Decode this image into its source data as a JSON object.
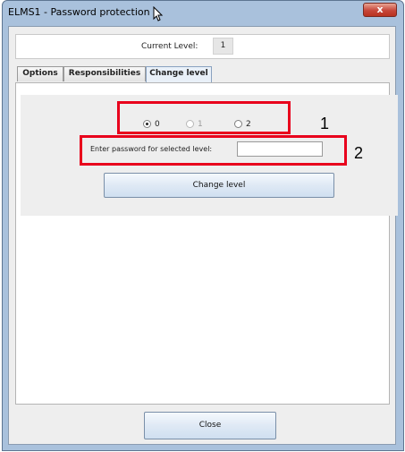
{
  "window": {
    "title": "ELMS1 - Password protection",
    "close_glyph": "x"
  },
  "level_panel": {
    "label": "Current Level:",
    "value": "1"
  },
  "tabs": [
    {
      "label": "Options",
      "active": false
    },
    {
      "label": "Responsibilities",
      "active": false
    },
    {
      "label": "Change level",
      "active": true
    }
  ],
  "change_level": {
    "levels": [
      {
        "label": "0",
        "selected": true,
        "enabled": true
      },
      {
        "label": "1",
        "selected": false,
        "enabled": false
      },
      {
        "label": "2",
        "selected": false,
        "enabled": true
      }
    ],
    "password_label": "Enter password for selected level:",
    "password_value": "",
    "button_label": "Change level"
  },
  "annotations": {
    "one": "1",
    "two": "2",
    "color": "#e8001c"
  },
  "footer": {
    "close_label": "Close"
  }
}
